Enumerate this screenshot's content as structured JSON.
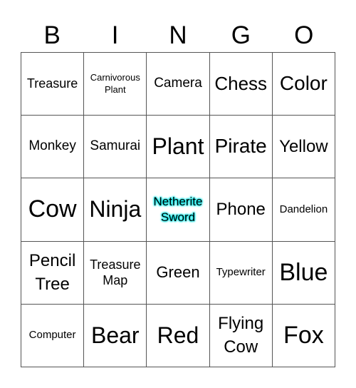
{
  "header": {
    "letters": [
      "B",
      "I",
      "N",
      "G",
      "O"
    ]
  },
  "free_space": {
    "highlight_color": "#00e5e5"
  },
  "cells": [
    "Treasure",
    "Carnivorous Plant",
    "Camera",
    "Chess",
    "Color",
    "Monkey",
    "Samurai",
    "Plant",
    "Pirate",
    "Yellow",
    "Cow",
    "Ninja",
    "Netherite Sword",
    "Phone",
    "Dandelion",
    "Pencil Tree",
    "Treasure Map",
    "Green",
    "Typewriter",
    "Blue",
    "Computer",
    "Bear",
    "Red",
    "Flying Cow",
    "Fox"
  ]
}
